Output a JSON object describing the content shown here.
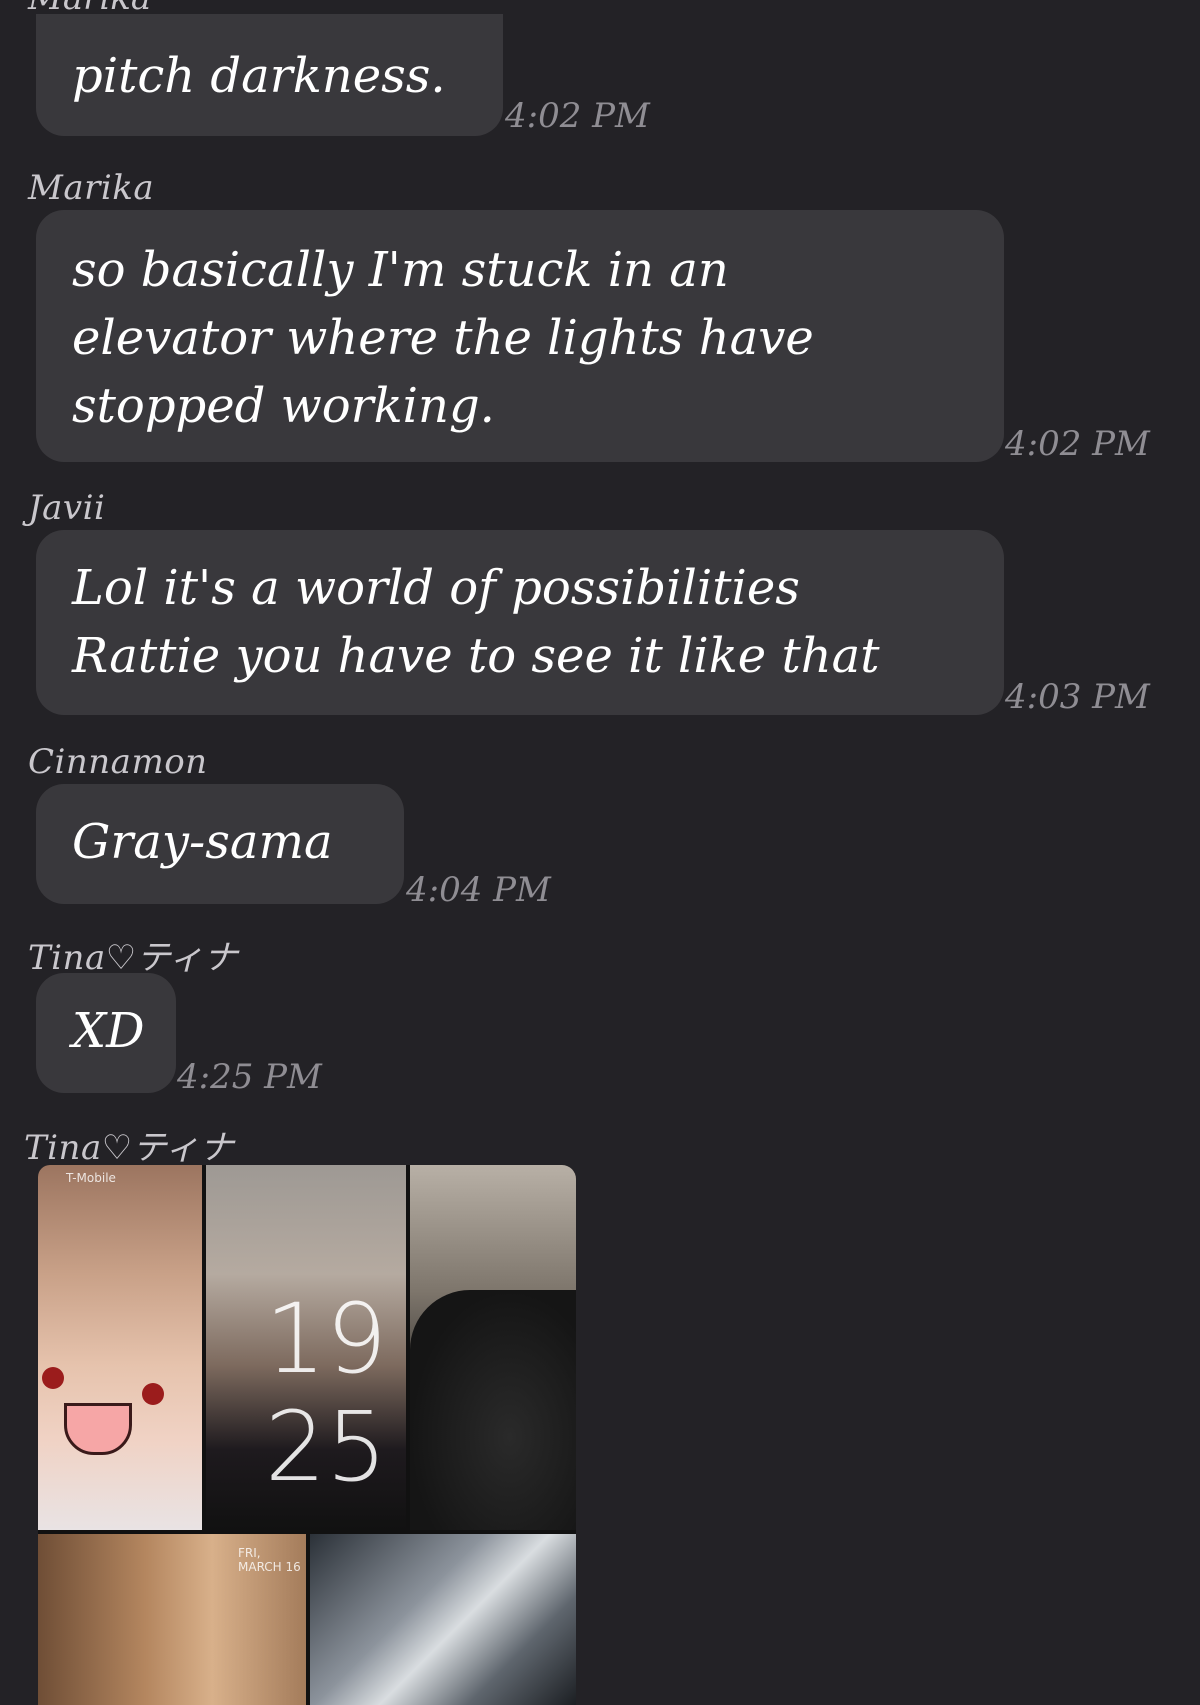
{
  "chat": {
    "partial_sender": "Marika",
    "messages": [
      {
        "sender": "",
        "text": "pitch darkness.",
        "time": "4:02 PM"
      },
      {
        "sender": "Marika",
        "text": "so basically I'm stuck in an\nelevator where the lights have\nstopped working.",
        "time": "4:02 PM"
      },
      {
        "sender": "Javii",
        "text": "Lol it's a world of possibilities\nRattie you have to see it like that",
        "time": "4:03 PM"
      },
      {
        "sender": "Cinnamon",
        "text": "Gray-sama",
        "time": "4:04 PM"
      },
      {
        "sender": "Tina♡ティナ",
        "text": "XD",
        "time": "4:25 PM"
      }
    ],
    "image_message": {
      "sender": "Tina♡ティナ",
      "image_description_icon": "photo-collage",
      "lock_screen_time": "19\n25",
      "carrier_text": "T-Mobile",
      "date_text": "FRI, MARCH 16"
    }
  }
}
